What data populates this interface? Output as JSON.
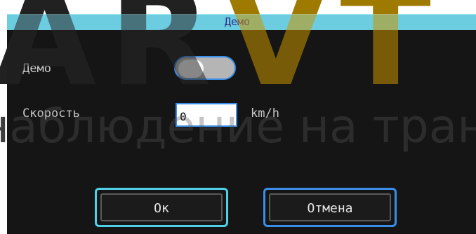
{
  "watermark": {
    "part1": "AR",
    "part2": "VT",
    "line": "наблюдение на транспорте"
  },
  "dialog": {
    "title": "Демо",
    "demo_label": "Демо",
    "demo_enabled": false,
    "speed_label": "Скорость",
    "speed_value": "0",
    "speed_unit": "km/h",
    "ok_label": "Ок",
    "cancel_label": "Отмена"
  },
  "colors": {
    "titlebar": "#6dcde0",
    "accent_blue": "#3a8de8",
    "accent_cyan": "#4fd0e6",
    "background": "#151515"
  }
}
